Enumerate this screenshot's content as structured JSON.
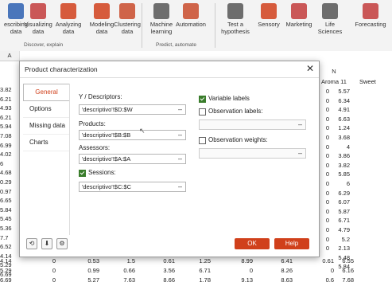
{
  "ribbon": {
    "buttons": [
      {
        "label": "escribing\ndata",
        "icon": "describing-data-icon",
        "color": "#2b5fb0"
      },
      {
        "label": "Visualizing\ndata",
        "icon": "visualizing-data-icon",
        "color": "#c23b3b"
      },
      {
        "label": "Analyzing\ndata",
        "icon": "analyzing-data-icon",
        "color": "#d0401b"
      },
      {
        "label": "Modeling\ndata",
        "icon": "modeling-data-icon",
        "color": "#d0401b"
      },
      {
        "label": "Clustering\ndata",
        "icon": "clustering-data-icon",
        "color": "#c84a2a"
      },
      {
        "label": "Machine\nlearning",
        "icon": "machine-learning-icon",
        "color": "#555"
      },
      {
        "label": "Automation",
        "icon": "automation-icon",
        "color": "#c84a2a"
      },
      {
        "label": "Test a\nhypothesis",
        "icon": "test-hypothesis-icon",
        "color": "#555"
      },
      {
        "label": "Sensory",
        "icon": "sensory-icon",
        "color": "#d0401b"
      },
      {
        "label": "Marketing",
        "icon": "marketing-icon",
        "color": "#c23b3b"
      },
      {
        "label": "Life\nSciences",
        "icon": "life-sciences-icon",
        "color": "#555"
      },
      {
        "label": "Forecasting",
        "icon": "forecasting-icon",
        "color": "#c23b3b"
      }
    ],
    "groups": [
      "Discover, explain",
      "Predict, automate"
    ]
  },
  "sheet": {
    "col_n": "N",
    "col_aroma": "Aroma 11",
    "col_sweet": "Sweet",
    "left_col": [
      "3.82",
      "6.21",
      "4.93",
      "6.21",
      "5.94",
      "7.08",
      "6.99",
      "4.02",
      "6",
      "4.68",
      "0.29",
      "0.97",
      "6.65",
      "5.84",
      "5.45",
      "5.36",
      "7.7",
      "6.52",
      "4.14",
      "5.29",
      "6.69"
    ],
    "n_col": [
      "0",
      "0",
      "0",
      "0",
      "0",
      "0",
      "0",
      "0",
      "0",
      "0",
      "0",
      "0",
      "0",
      "0",
      "0",
      "0",
      "0",
      "0",
      "0.61",
      "0",
      "0.6"
    ],
    "aroma_col": [
      "5.57",
      "6.34",
      "4.91",
      "6.63",
      "1.24",
      "3.68",
      "4",
      "3.86",
      "3.82",
      "5.85",
      "6",
      "6.29",
      "6.07",
      "5.87",
      "6.71",
      "4.79",
      "5.2",
      "2.13",
      "5.48",
      "5.84",
      "6.55",
      "6.4",
      "7.68"
    ],
    "mid_labels": [
      ".36",
      ".29",
      ".74",
      "1.31",
      ".78",
      ".03",
      ".21"
    ],
    "bottom_rows": [
      [
        "4.14",
        "0",
        "0.53",
        "1.5",
        "0.61",
        "1.25",
        "8.99",
        "6.41",
        "0.61",
        "6.55"
      ],
      [
        "5.29",
        "0",
        "0.99",
        "0.66",
        "3.56",
        "6.71",
        "0",
        "8.26",
        "0",
        "6.16"
      ],
      [
        "6.69",
        "0",
        "5.27",
        "7.63",
        "8.66",
        "1.78",
        "9.13",
        "8.63",
        "0.6",
        "7.68"
      ]
    ],
    "partial_row": [
      "6.52",
      "0",
      "3.81",
      "1.76",
      "2.11",
      "8.73",
      "10",
      "5.84"
    ]
  },
  "dialog": {
    "title": "Product characterization",
    "tabs": [
      "General",
      "Options",
      "Missing data",
      "Charts"
    ],
    "y_label": "Y / Descriptors:",
    "y_value": "'descriptivo'!$D:$W",
    "products_label": "Products:",
    "products_value": "'descriptivo'!$B:$B",
    "assessors_label": "Assessors:",
    "assessors_value": "'descriptivo'!$A:$A",
    "sessions_label": "Sessions:",
    "sessions_value": "'descriptivo'!$C:$C",
    "variable_labels": "Variable labels",
    "observation_labels": "Observation labels:",
    "observation_weights": "Observation weights:",
    "ok": "OK",
    "help": "Help",
    "accent": "#d0401b"
  }
}
